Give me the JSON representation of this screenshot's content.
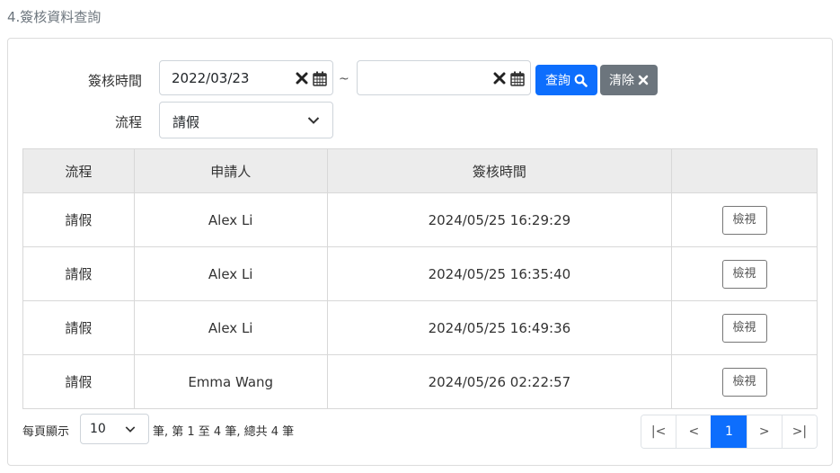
{
  "page": {
    "title": "4.簽核資料查詢"
  },
  "filters": {
    "date_label": "簽核時間",
    "date_from": "2022/03/23",
    "date_to": "",
    "range_sep": "~",
    "flow_label": "流程",
    "flow_value": "請假",
    "search_label": "查詢",
    "clear_label": "清除"
  },
  "table": {
    "headers": [
      "流程",
      "申請人",
      "簽核時間",
      ""
    ],
    "view_label": "檢視",
    "rows": [
      {
        "flow": "請假",
        "applicant": "Alex Li",
        "time": "2024/05/25 16:29:29"
      },
      {
        "flow": "請假",
        "applicant": "Alex Li",
        "time": "2024/05/25 16:35:40"
      },
      {
        "flow": "請假",
        "applicant": "Alex Li",
        "time": "2024/05/25 16:49:36"
      },
      {
        "flow": "請假",
        "applicant": "Emma Wang",
        "time": "2024/05/26 02:22:57"
      }
    ]
  },
  "footer": {
    "per_page_label": "每頁顯示",
    "per_page_value": "10",
    "summary": "筆, 第 1 至 4 筆, 總共 4 筆"
  },
  "pagination": {
    "first": "|<",
    "prev": "<",
    "current": "1",
    "next": ">",
    "last": ">|"
  },
  "colors": {
    "primary": "#0d6efd",
    "secondary": "#6c757d"
  }
}
